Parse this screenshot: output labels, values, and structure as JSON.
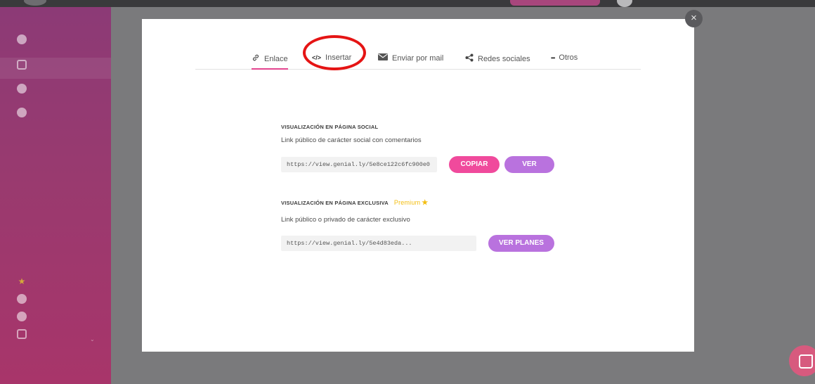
{
  "modal": {
    "close_label": "×",
    "tabs": [
      {
        "icon": "link-icon",
        "glyph": "🔗",
        "label": "Enlace"
      },
      {
        "icon": "code-icon",
        "glyph": "</>",
        "label": "Insertar"
      },
      {
        "icon": "mail-icon",
        "glyph": "✉",
        "label": "Enviar por mail"
      },
      {
        "icon": "share-icon",
        "glyph": "<",
        "label": "Redes sociales"
      },
      {
        "icon": "more-icon",
        "glyph": "•••",
        "label": "Otros"
      }
    ],
    "social": {
      "title": "VISUALIZACIÓN EN PÁGINA SOCIAL",
      "description": "Link público de carácter social con comentarios",
      "url": "https://view.genial.ly/5e8ce122c6fc900e0:",
      "copy_label": "COPIAR",
      "view_label": "VER"
    },
    "exclusive": {
      "title": "VISUALIZACIÓN EN PÁGINA EXCLUSIVA",
      "badge": "Premium",
      "description": "Link público o privado de carácter exclusivo",
      "url": "https://view.genial.ly/5e4d83eda...",
      "plans_label": "VER PLANES"
    }
  },
  "colors": {
    "accent_pink": "#f04a9c",
    "accent_purple": "#b972de",
    "premium_yellow": "#f3bd10",
    "highlight_red": "#e51414"
  }
}
